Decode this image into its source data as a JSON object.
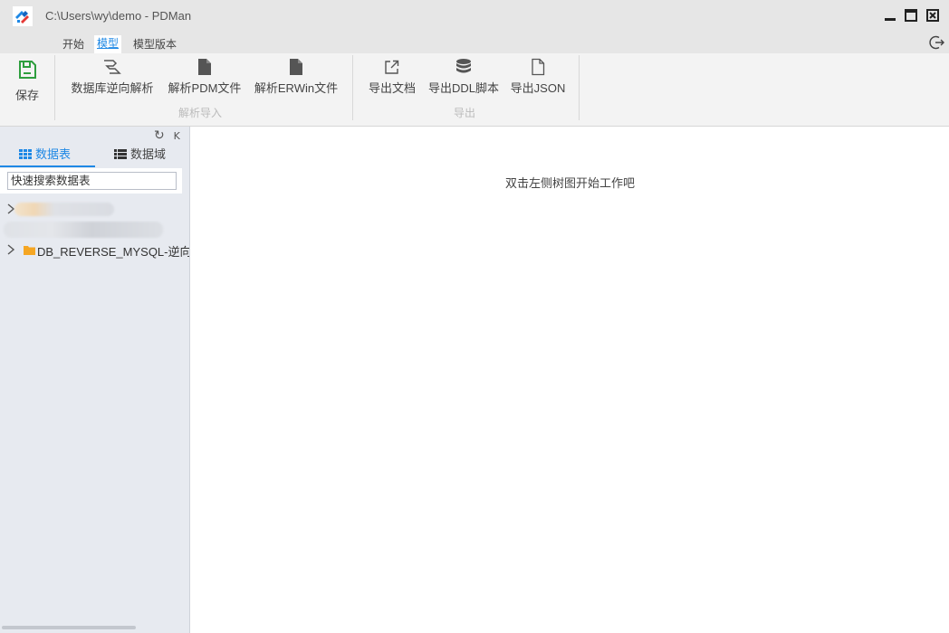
{
  "window": {
    "title": "C:\\Users\\wy\\demo - PDMan"
  },
  "menu": {
    "tabs": [
      {
        "label": "开始"
      },
      {
        "label": "模型"
      },
      {
        "label": "模型版本"
      }
    ],
    "active_tab": "模型"
  },
  "ribbon": {
    "save_label": "保存",
    "groups": [
      {
        "label": "解析导入",
        "buttons": [
          {
            "label": "数据库逆向解析",
            "icon": "database-reverse-icon"
          },
          {
            "label": "解析PDM文件",
            "icon": "file-icon"
          },
          {
            "label": "解析ERWin文件",
            "icon": "file-icon"
          }
        ]
      },
      {
        "label": "导出",
        "buttons": [
          {
            "label": "导出文档",
            "icon": "export-icon"
          },
          {
            "label": "导出DDL脚本",
            "icon": "database-icon"
          },
          {
            "label": "导出JSON",
            "icon": "file-outline-icon"
          }
        ]
      }
    ]
  },
  "sidebar": {
    "tools": {
      "refresh": "↻",
      "collapse": "K"
    },
    "tabs": [
      {
        "label": "数据表",
        "active": true
      },
      {
        "label": "数据域",
        "active": false
      }
    ],
    "search_placeholder": "快速搜索数据表",
    "tree": [
      {
        "label": "DB_REVERSE_MYSQL-逆向解析"
      }
    ]
  },
  "main": {
    "empty_message": "双击左侧树图开始工作吧"
  },
  "colors": {
    "accent": "#1e88e5",
    "save_icon": "#2e9e3e",
    "folder": "#f5a623"
  }
}
